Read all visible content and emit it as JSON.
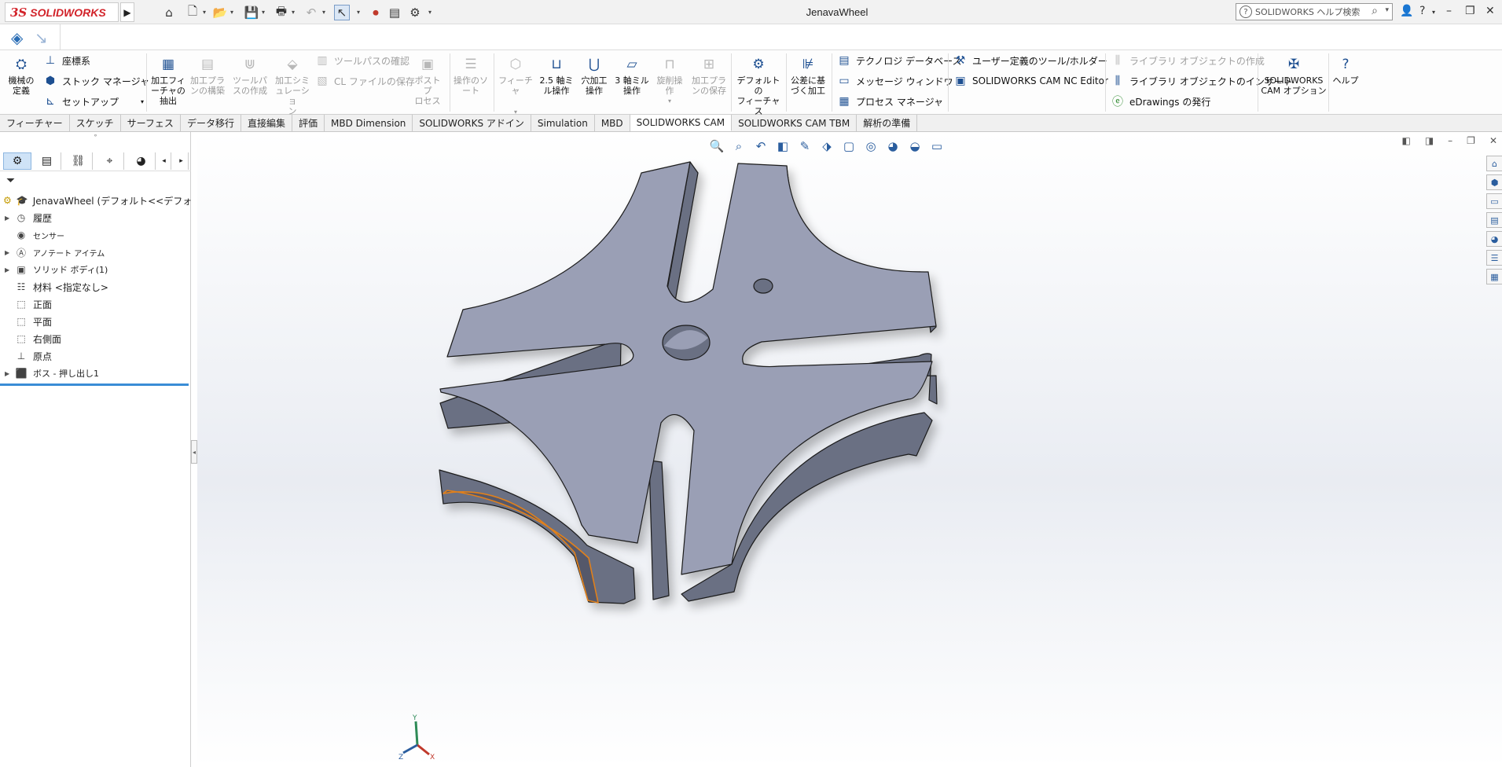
{
  "app": {
    "logo_text": "SOLIDWORKS",
    "document_title": "JenavaWheel",
    "search_placeholder": "SOLIDWORKS ヘルプ検索"
  },
  "ribbon": {
    "mech_def": "機械の\n定義",
    "coord": "座標系",
    "stock": "ストック マネージャ",
    "setup": "セットアップ",
    "extract": "加工フィ\nーチャの\n抽出",
    "plan": "加工プラ\nンの構築",
    "toolpath": "ツールパ\nスの作成",
    "simulate": "加工シミ\nュレーショ\nン",
    "toolpath_check": "ツールパスの確認",
    "cl_save": "CL ファイルの保存",
    "post": "ポスト プ\nロセス",
    "op_sort": "操作のソ\nート",
    "feature": "フィーチャ",
    "op25": "2.5 軸ミ\nル操作",
    "hole": "穴加工\n操作",
    "op3": "3 軸ミル\n操作",
    "turn": "旋削操\n作",
    "save_plan": "加工プラ\nンの保存",
    "default_strategy": "デフォルトの\nフィーチャ ス\nトラテジ",
    "tol_machining": "公差に基\nづく加工",
    "techdb": "テクノロジ データベース",
    "msg_window": "メッセージ ウィンドウ",
    "process_mgr": "プロセス マネージャ",
    "user_tools": "ユーザー定義のツール/ホルダー",
    "nc_editor": "SOLIDWORKS CAM NC Editor",
    "lib_create": "ライブラリ オブジェクトの作成",
    "lib_insert": "ライブラリ オブジェクトのインサート",
    "edrawings": "eDrawings の発行",
    "cam_options": "SOLIDWORKS\nCAM オプション",
    "help": "ヘルプ"
  },
  "tabs": [
    {
      "label": "フィーチャー",
      "active": false
    },
    {
      "label": "スケッチ",
      "active": false
    },
    {
      "label": "サーフェス",
      "active": false
    },
    {
      "label": "データ移行",
      "active": false
    },
    {
      "label": "直接編集",
      "active": false
    },
    {
      "label": "評価",
      "active": false
    },
    {
      "label": "MBD Dimension",
      "active": false
    },
    {
      "label": "SOLIDWORKS アドイン",
      "active": false
    },
    {
      "label": "Simulation",
      "active": false
    },
    {
      "label": "MBD",
      "active": false
    },
    {
      "label": "SOLIDWORKS CAM",
      "active": true
    },
    {
      "label": "SOLIDWORKS CAM TBM",
      "active": false
    },
    {
      "label": "解析の準備",
      "active": false
    }
  ],
  "tree": {
    "root": "JenavaWheel  (デフォルト<<デフォルト>_表",
    "items": [
      {
        "label": "履歴",
        "expandable": true
      },
      {
        "label": "センサー",
        "expandable": false
      },
      {
        "label": "アノテート アイテム",
        "expandable": true
      },
      {
        "label": "ソリッド ボディ(1)",
        "expandable": true
      },
      {
        "label": "材料 <指定なし>",
        "expandable": false
      },
      {
        "label": "正面",
        "expandable": false
      },
      {
        "label": "平面",
        "expandable": false
      },
      {
        "label": "右側面",
        "expandable": false
      },
      {
        "label": "原点",
        "expandable": false
      },
      {
        "label": "ボス - 押し出し1",
        "expandable": true
      }
    ]
  },
  "colors": {
    "top_face": "#9a9fb5",
    "side_face": "#6a6f83",
    "dark_side": "#55596b",
    "edge": "#1b1b1b",
    "highlight": "#e0801a",
    "accent": "#3a8dd6"
  },
  "triad": {
    "x": "X",
    "y": "Y",
    "z": "Z"
  }
}
